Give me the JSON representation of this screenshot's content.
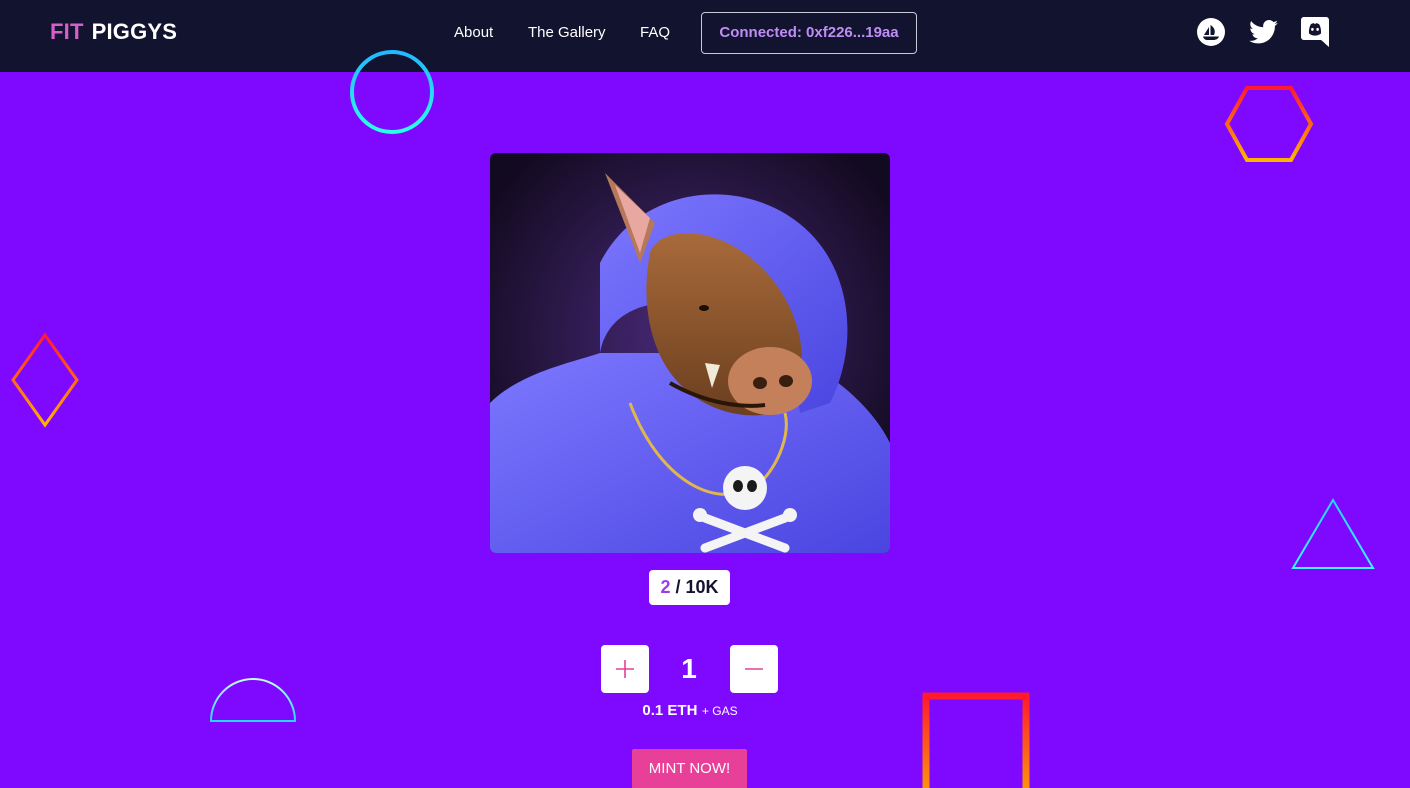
{
  "brand": {
    "part1": "FIT",
    "part2": "PIGGYS"
  },
  "nav": {
    "links": [
      {
        "label": "About"
      },
      {
        "label": "The Gallery"
      },
      {
        "label": "FAQ"
      }
    ],
    "connect_label": "Connected: 0xf226...19aa"
  },
  "socials": [
    {
      "icon": "opensea-icon"
    },
    {
      "icon": "twitter-icon"
    },
    {
      "icon": "discord-icon"
    }
  ],
  "mint": {
    "minted": "2",
    "supply": "/ 10K",
    "quantity": "1",
    "price": "0.1 ETH",
    "gas": "+ GAS",
    "button_label": "MINT NOW!"
  },
  "colors": {
    "background": "#7f08ff",
    "navbar": "#11132f",
    "accent_pink": "#e83f98",
    "brand_pink": "#d65fc9",
    "cyan": "#22f0ff",
    "orange": "#ffb400",
    "red": "#ff1a2e"
  }
}
